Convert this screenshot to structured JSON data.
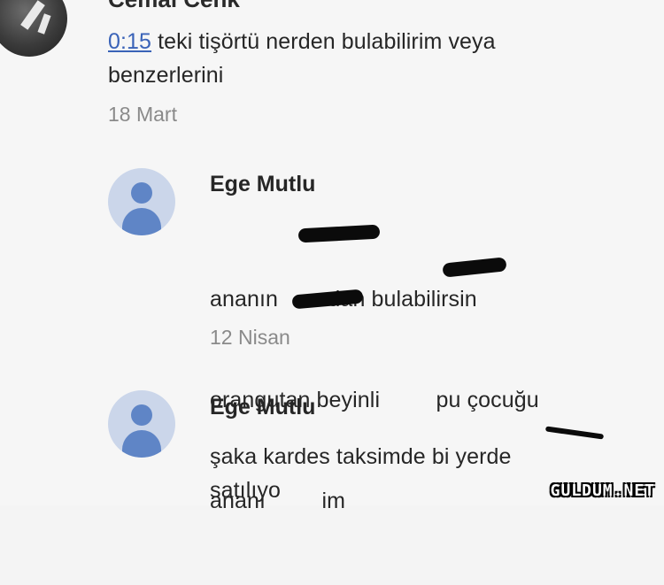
{
  "top_comment": {
    "author": "Cemal Cenk",
    "timestamp": "0:15",
    "text_line1": " teki tişörtü nerden bulabilirim veya",
    "text_line2": "benzerlerini",
    "date": "18 Mart"
  },
  "replies": [
    {
      "author": "Ege Mutlu",
      "lines": [
        "ananın        dan bulabilirsin",
        "orangutan beyinli         pu çocuğu",
        "ananı         im"
      ],
      "date": "12 Nisan"
    },
    {
      "author": "Ege Mutlu",
      "lines": [
        "şaka kardes taksimde bi yerde",
        "satılıyo"
      ],
      "date": ""
    }
  ],
  "watermark": "GULDUM.NET",
  "icons": {
    "avatar": "default-user-avatar-icon"
  },
  "colors": {
    "link": "#3a63b8",
    "avatar_bg": "#cbd6ea",
    "avatar_fg": "#5f85c6",
    "date": "#8a8a8a"
  }
}
